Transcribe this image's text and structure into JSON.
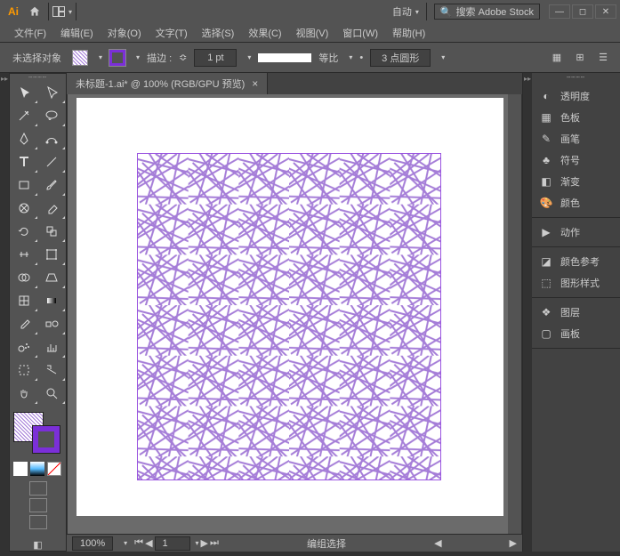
{
  "titlebar": {
    "app_abbrev": "Ai",
    "auto_label": "自动",
    "search_placeholder": "搜索 Adobe Stock"
  },
  "menus": [
    "文件(F)",
    "编辑(E)",
    "对象(O)",
    "文字(T)",
    "选择(S)",
    "效果(C)",
    "视图(V)",
    "窗口(W)",
    "帮助(H)"
  ],
  "control": {
    "noselection": "未选择对象",
    "stroke_label": "描边 :",
    "stroke_val": "1 pt",
    "ratio_label": "等比",
    "round_val": "3 点圆形"
  },
  "doc": {
    "tab_title": "未标题-1.ai* @ 100% (RGB/GPU 预览)"
  },
  "status": {
    "zoom": "100%",
    "page": "1",
    "mode": "编组选择"
  },
  "panels": {
    "g1": [
      {
        "icon": "transparency-icon",
        "label": "透明度"
      },
      {
        "icon": "swatches-icon",
        "label": "色板"
      },
      {
        "icon": "brushes-icon",
        "label": "画笔"
      },
      {
        "icon": "symbols-icon",
        "label": "符号"
      },
      {
        "icon": "gradient-icon",
        "label": "渐变"
      },
      {
        "icon": "color-icon",
        "label": "颜色"
      }
    ],
    "g2": [
      {
        "icon": "actions-icon",
        "label": "动作"
      }
    ],
    "g3": [
      {
        "icon": "color-guide-icon",
        "label": "颜色参考"
      },
      {
        "icon": "graphic-styles-icon",
        "label": "图形样式"
      }
    ],
    "g4": [
      {
        "icon": "layers-icon",
        "label": "图层"
      },
      {
        "icon": "artboards-icon",
        "label": "画板"
      }
    ]
  },
  "tools": [
    {
      "n": "selection-tool"
    },
    {
      "n": "direct-selection-tool"
    },
    {
      "n": "magic-wand-tool"
    },
    {
      "n": "lasso-tool"
    },
    {
      "n": "pen-tool"
    },
    {
      "n": "curvature-tool"
    },
    {
      "n": "type-tool"
    },
    {
      "n": "line-tool"
    },
    {
      "n": "rectangle-tool"
    },
    {
      "n": "paintbrush-tool"
    },
    {
      "n": "shaper-tool"
    },
    {
      "n": "eraser-tool"
    },
    {
      "n": "rotate-tool"
    },
    {
      "n": "scale-tool"
    },
    {
      "n": "width-tool"
    },
    {
      "n": "free-transform-tool"
    },
    {
      "n": "shape-builder-tool"
    },
    {
      "n": "perspective-tool"
    },
    {
      "n": "mesh-tool"
    },
    {
      "n": "gradient-tool"
    },
    {
      "n": "eyedropper-tool"
    },
    {
      "n": "blend-tool"
    },
    {
      "n": "symbol-sprayer-tool"
    },
    {
      "n": "graph-tool"
    },
    {
      "n": "artboard-tool"
    },
    {
      "n": "slice-tool"
    },
    {
      "n": "hand-tool"
    },
    {
      "n": "zoom-tool"
    }
  ]
}
